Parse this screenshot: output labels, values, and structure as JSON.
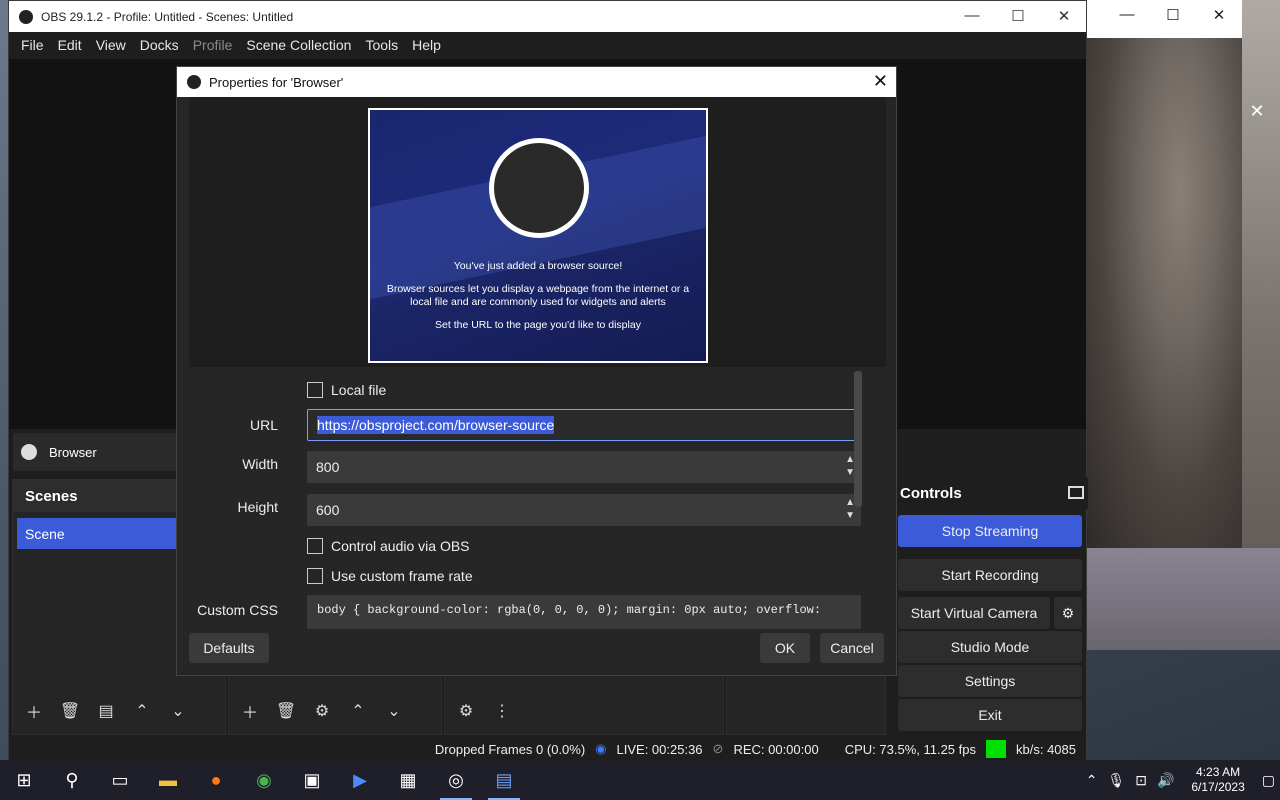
{
  "obs": {
    "title": "OBS 29.1.2 - Profile: Untitled - Scenes: Untitled",
    "menu": [
      "File",
      "Edit",
      "View",
      "Docks",
      "Profile",
      "Scene Collection",
      "Tools",
      "Help"
    ],
    "source_name": "Browser",
    "scenes_title": "Scenes",
    "scene_item": "Scene",
    "controls_title": "Controls",
    "controls": {
      "stop_streaming": "Stop Streaming",
      "start_recording": "Start Recording",
      "start_virtual_camera": "Start Virtual Camera",
      "studio_mode": "Studio Mode",
      "settings": "Settings",
      "exit": "Exit"
    },
    "status": {
      "dropped_frames": "Dropped Frames 0 (0.0%)",
      "live": "LIVE: 00:25:36",
      "rec": "REC: 00:00:00",
      "cpu": "CPU: 73.5%, 11.25 fps",
      "kbs": "kb/s: 4085"
    }
  },
  "dialog": {
    "title": "Properties for 'Browser'",
    "preview": {
      "line1": "You've just added a browser source!",
      "line2": "Browser sources let you display a webpage from the internet or a local file and are commonly used for widgets and alerts",
      "line3": "Set the URL to the page you'd like to display"
    },
    "local_file_label": "Local file",
    "url_label": "URL",
    "url_value": "https://obsproject.com/browser-source",
    "width_label": "Width",
    "width_value": "800",
    "height_label": "Height",
    "height_value": "600",
    "control_audio_label": "Control audio via OBS",
    "custom_frame_label": "Use custom frame rate",
    "custom_css_label": "Custom CSS",
    "custom_css_value": "body { background-color: rgba(0, 0, 0, 0); margin: 0px auto; overflow:",
    "defaults_btn": "Defaults",
    "ok_btn": "OK",
    "cancel_btn": "Cancel"
  },
  "taskbar": {
    "time": "4:23 AM",
    "date": "6/17/2023"
  },
  "colors": {
    "accent": "#3b5bd9",
    "live_indicator": "#00e000"
  }
}
